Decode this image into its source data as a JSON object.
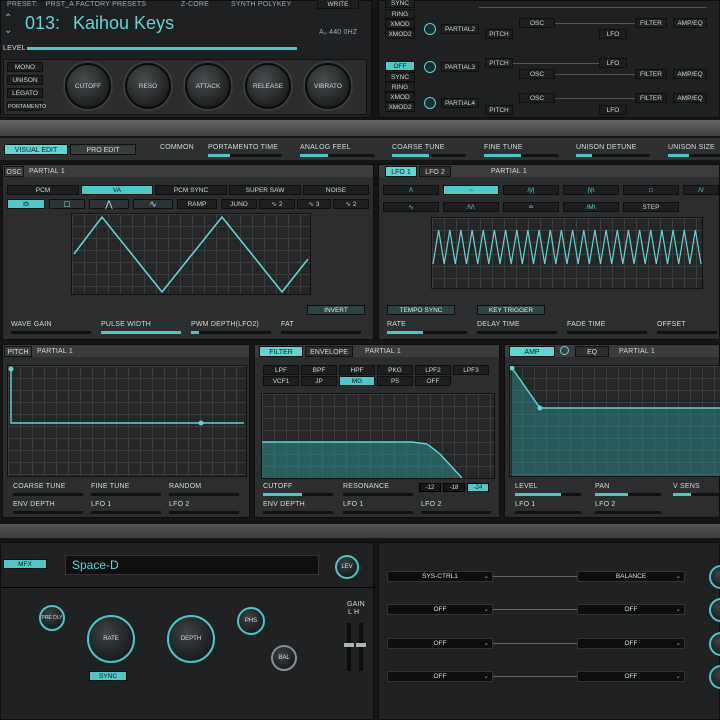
{
  "header": {
    "preset_prefix": "Preset:",
    "preset_bank": "PRST_A Factory Presets",
    "engine_label": "Z-CORE",
    "engine_value": "Synth PolyKey",
    "write_label": "WRITE",
    "preset_number": "013:",
    "preset_name": "Kaihou Keys",
    "tuning": "A₀ 440 0Hz",
    "level_label": "LEVEL"
  },
  "voice_modes": [
    "MONO",
    "UNISON",
    "LEGATO",
    "PORTAMENTO"
  ],
  "knobs_top": [
    "CUTOFF",
    "RESO",
    "ATTACK",
    "RELEASE",
    "VIBRATO"
  ],
  "partial_rows": [
    {
      "modes": [
        "SYNC",
        "RING",
        "XMOD",
        "XMOD2"
      ],
      "name": "PARTIAL2",
      "a": "PITCH",
      "b": "OSC",
      "c": "LFO",
      "d": "FILTER",
      "e": "AMP/EQ"
    },
    {
      "modes": [
        "OFF",
        "SYNC",
        "RING",
        "XMOD",
        "XMOD2"
      ],
      "name": "PARTIAL3",
      "a": "PITCH",
      "b": "OSC",
      "c": "LFO",
      "d": "FILTER",
      "e": "AMP/EQ"
    },
    {
      "modes": [],
      "name": "PARTIAL4",
      "a": "PITCH",
      "b": "OSC",
      "c": "LFO",
      "d": "FILTER",
      "e": "AMP/EQ"
    }
  ],
  "common_bar": {
    "visual_edit": "VISUAL EDIT",
    "pro_edit": "PRO EDIT",
    "common": "COMMON",
    "params": [
      "PORTAMENTO TIME",
      "ANALOG FEEL",
      "COARSE TUNE",
      "FINE TUNE",
      "UNISON DETUNE",
      "UNISON SIZE"
    ]
  },
  "osc": {
    "tab": "OSC",
    "partial": "PARTIAL 1",
    "types": [
      "PCM",
      "VA",
      "PCM SYNC",
      "SUPER SAW",
      "NOISE"
    ],
    "selected_type": "VA",
    "waves": [
      "RAMP",
      "JUNO",
      "2",
      "3",
      "2"
    ],
    "invert": "INVERT",
    "params": [
      "WAVE GAIN",
      "PULSE WIDTH",
      "PWM DEPTH(LFO2)",
      "FAT"
    ]
  },
  "lfo": {
    "tabs": [
      "LFO 1",
      "LFO 2"
    ],
    "partial": "PARTIAL 1",
    "step": "STEP",
    "tempo_sync": "TEMPO SYNC",
    "key_trigger": "KEY TRIGGER",
    "params": [
      "RATE",
      "DELAY TIME",
      "FADE TIME",
      "OFFSET"
    ]
  },
  "pitch": {
    "tab": "PITCH",
    "partial": "PARTIAL 1",
    "params_row1": [
      "COARSE TUNE",
      "FINE TUNE",
      "RANDOM"
    ],
    "params_row2": [
      "ENV DEPTH",
      "LFO 1",
      "LFO 2"
    ]
  },
  "filter": {
    "tabs": [
      "FILTER",
      "ENVELOPE"
    ],
    "partial": "PARTIAL 1",
    "types_row1": [
      "LPF",
      "BPF",
      "HPF",
      "PKG",
      "LPF2",
      "LPF3"
    ],
    "types_row2": [
      "VCF1",
      "JP",
      "MG",
      "P5",
      "OFF"
    ],
    "selected": "MG",
    "params_row1": [
      "CUTOFF",
      "RESONANCE"
    ],
    "slopes": [
      "-12",
      "-18",
      "-24"
    ],
    "params_row2": [
      "ENV DEPTH",
      "LFO 1",
      "LFO 2"
    ]
  },
  "amp": {
    "tabs": [
      "AMP",
      "EQ"
    ],
    "partial": "PARTIAL 1",
    "params_row1": [
      "LEVEL",
      "PAN",
      "V SENS"
    ],
    "params_row2": [
      "LFO 1",
      "LFO 2"
    ]
  },
  "mfx": {
    "label": "MFX",
    "name": "Space-D",
    "lev": "LEV",
    "knobs": [
      "RATE",
      "DEPTH"
    ],
    "small_knobs": [
      "PRE DLY",
      "PHS",
      "BAL"
    ],
    "sync": "SYNC",
    "gain": "GAIN",
    "gain_lr": "L  H"
  },
  "control_rows": [
    {
      "src": "SYS-CTRL1",
      "dst": "BALANCE"
    },
    {
      "src": "OFF",
      "dst": "OFF"
    },
    {
      "src": "OFF",
      "dst": "OFF"
    },
    {
      "src": "OFF",
      "dst": "OFF"
    }
  ],
  "colors": {
    "accent": "#48c8c8",
    "panel": "#2b2d2e",
    "bg": "#151515"
  }
}
